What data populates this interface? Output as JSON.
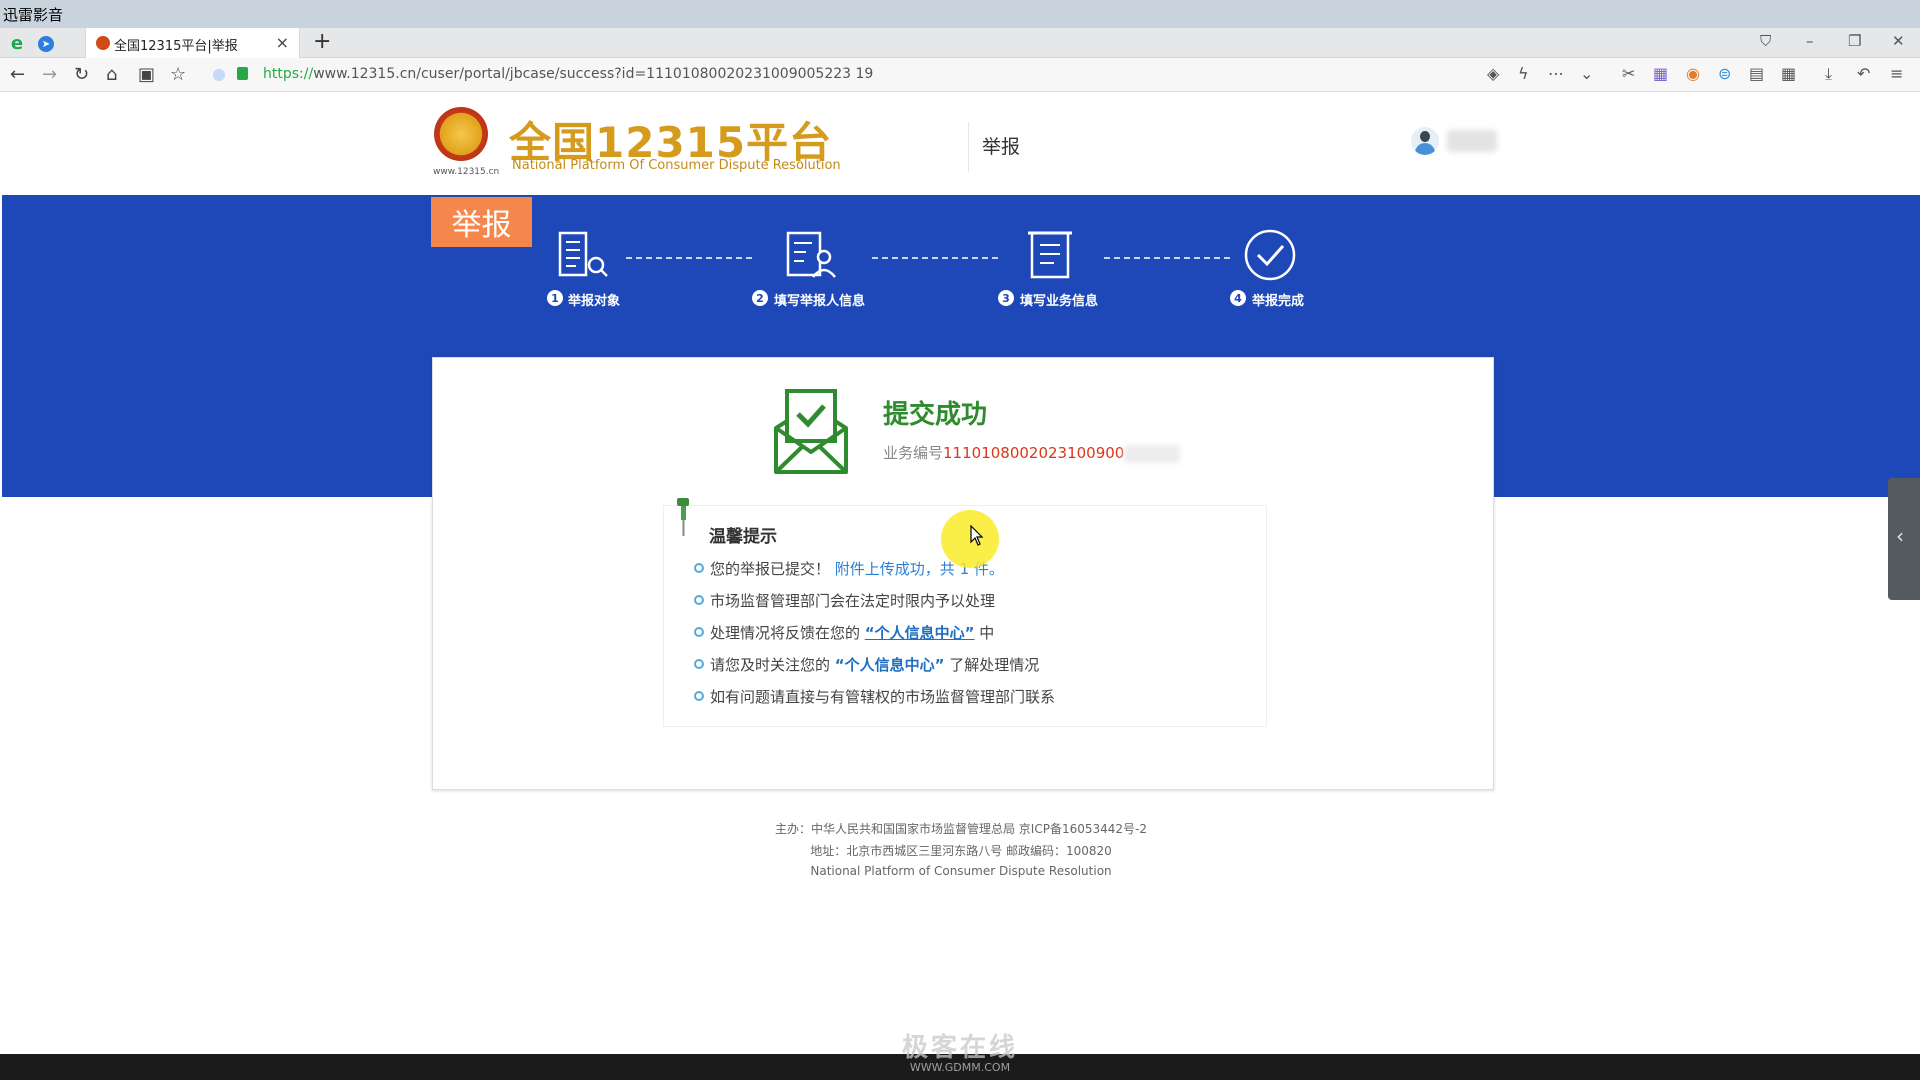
{
  "player": {
    "title": "迅雷影音"
  },
  "browser": {
    "tab_title": "全国12315平台|举报",
    "tab_close": "×",
    "new_tab": "+",
    "url_scheme": "https://",
    "url_rest": "www.12315.cn/cuser/portal/jbcase/success?id=11101080020231009005223 19"
  },
  "header": {
    "site_name": "全国12315平台",
    "site_name_en": "National Platform Of Consumer Dispute Resolution",
    "emblem_url": "www.12315.cn",
    "nav_label": "举报"
  },
  "banner": {
    "tag": "举报",
    "steps": [
      {
        "num": "1",
        "label": "举报对象"
      },
      {
        "num": "2",
        "label": "填写举报人信息"
      },
      {
        "num": "3",
        "label": "填写业务信息"
      },
      {
        "num": "4",
        "label": "举报完成"
      }
    ]
  },
  "result": {
    "title": "提交成功",
    "case_prefix": "业务编号",
    "case_number": "1110108002023100900"
  },
  "tips": {
    "title": "温馨提示",
    "t1_a": "您的举报已提交！",
    "t1_b": "附件上传成功，共 1 件。",
    "t2": "市场监督管理部门会在法定时限内予以处理",
    "t3_a": "处理情况将反馈在您的",
    "t3_link": "“个人信息中心”",
    "t3_b": "中",
    "t4_a": "请您及时关注您的",
    "t4_link": "“个人信息中心”",
    "t4_b": "了解处理情况",
    "t5": "如有问题请直接与有管辖权的市场监督管理部门联系"
  },
  "footer": {
    "line1": "主办：中华人民共和国国家市场监督管理总局 京ICP备16053442号-2",
    "line2": "地址：北京市西城区三里河东路八号 邮政编码：100820",
    "line3": "National Platform of Consumer Dispute Resolution"
  },
  "watermark": {
    "logo": "极客在线",
    "url": "WWW.GDMM.COM"
  },
  "colors": {
    "banner": "#1e48b8",
    "accent_gold": "#d59b1c",
    "success": "#2e8b2e",
    "tag": "#f5874c",
    "case_red": "#d9361a"
  }
}
